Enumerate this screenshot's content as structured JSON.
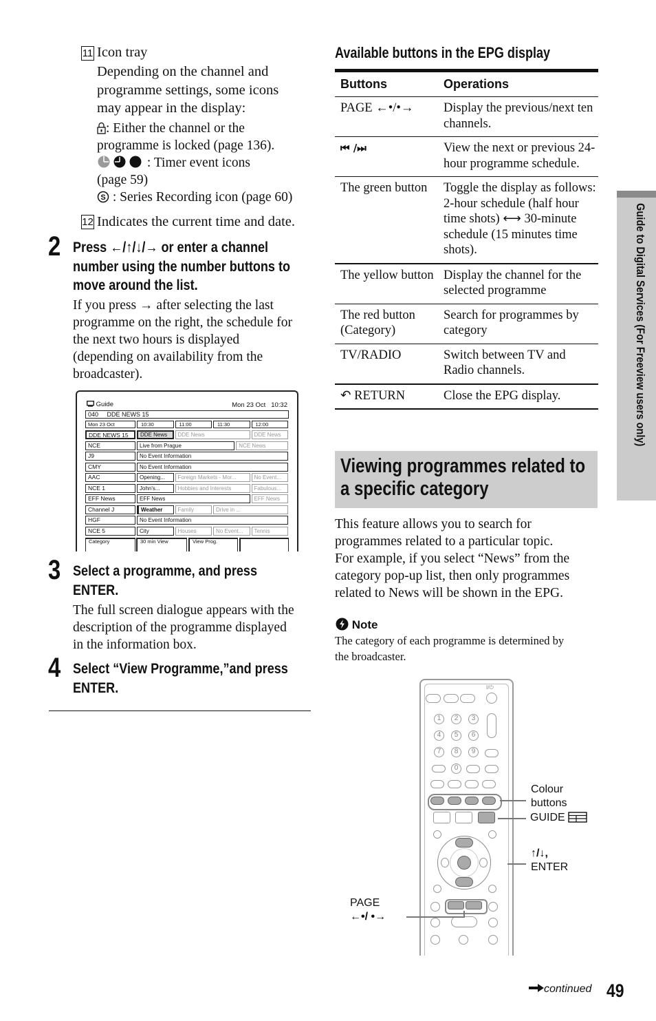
{
  "left_column": {
    "item11": {
      "number": "11",
      "title": "Icon tray",
      "description": [
        "Depending on the channel and",
        "programme settings, some icons",
        "may appear in the display:"
      ],
      "lock_icon_text": [
        ": Either the channel or the",
        "programme is locked (page 136)."
      ],
      "timer_icons_text": [
        ": Timer event icons",
        "(page 59)"
      ],
      "series_icon_text": ": Series Recording icon (page 60)"
    },
    "item12": {
      "number": "12",
      "text": "Indicates the current time and date."
    },
    "step2": {
      "number": "2",
      "title_lines": [
        "Press ←/↑/↓/→ or enter a channel",
        "number using the number buttons to",
        "move around the list."
      ],
      "body_lines": [
        "If you press → after selecting the last",
        "programme on the right, the schedule for",
        "the next two hours is displayed",
        "(depending on availability from the",
        "broadcaster)."
      ]
    },
    "step3": {
      "number": "3",
      "title_lines": [
        "Select a programme, and press",
        "ENTER."
      ],
      "body_lines": [
        "The full screen dialogue appears with the",
        "description of the programme displayed",
        "in the information box."
      ]
    },
    "step4": {
      "number": "4",
      "title_lines": [
        "Select “View Programme,”and press",
        "ENTER."
      ]
    }
  },
  "epg_screen": {
    "title": "Guide",
    "datetime": "Mon 23 Oct   10:32",
    "current_channel": "040     DDE NEWS 15",
    "date_cell": "Mon 23 Oct",
    "times": [
      "10:30",
      "11:00",
      "11:30",
      "12:00"
    ],
    "rows": [
      {
        "channel": "DDE NEWS 15",
        "programmes": [
          {
            "title": "DDE News",
            "span": 1,
            "style": "selected"
          },
          {
            "title": "DDE News",
            "span": 2,
            "style": "dim"
          },
          {
            "title": "DDE News",
            "span": 1,
            "style": "dim"
          }
        ]
      },
      {
        "channel": "NCE",
        "programmes": [
          {
            "title": "Live from Prague",
            "span": 2.6,
            "style": "normal"
          },
          {
            "title": "NCE News",
            "span": 1.4,
            "style": "dim"
          }
        ]
      },
      {
        "channel": "J9",
        "programmes": [
          {
            "title": "No Event Information",
            "span": 4,
            "style": "normal"
          }
        ]
      },
      {
        "channel": "CMY",
        "programmes": [
          {
            "title": "No Event Information",
            "span": 4,
            "style": "normal"
          }
        ]
      },
      {
        "channel": "AAC",
        "programmes": [
          {
            "title": "Opening...",
            "span": 1,
            "style": "normal"
          },
          {
            "title": "Foreign Markets - Mor...",
            "span": 2,
            "style": "dim"
          },
          {
            "title": "No Event...",
            "span": 1,
            "style": "dim"
          }
        ]
      },
      {
        "channel": "NCE 1",
        "programmes": [
          {
            "title": "John's...",
            "span": 1,
            "style": "normal"
          },
          {
            "title": "Hobbies and Interests",
            "span": 2,
            "style": "dim"
          },
          {
            "title": "Fabulous...",
            "span": 1,
            "style": "dim"
          }
        ]
      },
      {
        "channel": "EFF News",
        "programmes": [
          {
            "title": "EFF News",
            "span": 3,
            "style": "normal"
          },
          {
            "title": "EFF News",
            "span": 1,
            "style": "dim"
          }
        ]
      },
      {
        "channel": "Channel J",
        "programmes": [
          {
            "title": "Weather",
            "span": 1,
            "style": "bold"
          },
          {
            "title": "Family",
            "span": 1,
            "style": "dim"
          },
          {
            "title": "Drive in ...",
            "span": 2,
            "style": "dim"
          }
        ]
      },
      {
        "channel": "HGF",
        "programmes": [
          {
            "title": "No Event Information",
            "span": 4,
            "style": "normal"
          }
        ]
      },
      {
        "channel": "NCE 5",
        "programmes": [
          {
            "title": "City",
            "span": 1,
            "style": "normal"
          },
          {
            "title": "Houses",
            "span": 1,
            "style": "dim"
          },
          {
            "title": "No Event...",
            "span": 1,
            "style": "dim"
          },
          {
            "title": "Tennis",
            "span": 1,
            "style": "dim"
          }
        ]
      }
    ],
    "footer_buttons": [
      "Category",
      "30 min View",
      "View Prog."
    ]
  },
  "buttons_table": {
    "title": "Available buttons in the EPG display",
    "headers": [
      "Buttons",
      "Operations"
    ],
    "rows": [
      {
        "button": "PAGE ←•/•→",
        "operation": "Display the previous/next ten channels."
      },
      {
        "button": "⏮ /⏭",
        "operation": "View the next or previous 24-hour programme schedule."
      },
      {
        "button": "The green button",
        "operation": "Toggle the display as follows:\n2-hour schedule (half hour time shots) ⟷ 30-minute schedule (15 minutes time shots)."
      },
      {
        "button": "The yellow button",
        "operation": "Display the channel for the selected programme"
      },
      {
        "button": "The red button (Category)",
        "operation": "Search for programmes by category"
      },
      {
        "button": "TV/RADIO",
        "operation": "Switch between TV and Radio channels."
      },
      {
        "button": "↶ RETURN",
        "operation": "Close the EPG display."
      }
    ]
  },
  "section": {
    "title_lines": [
      "Viewing programmes related to",
      "a specific category"
    ],
    "body_lines": [
      "This feature allows you to search for",
      "programmes related to a particular topic.",
      "For example, if you select “News” from the",
      "category pop-up list, then only programmes",
      "related to News will be shown in the EPG."
    ],
    "note_label": "Note",
    "note_lines": [
      "The category of each programme is determined by",
      "the broadcaster."
    ]
  },
  "remote_diagram": {
    "number_buttons": [
      "1",
      "2",
      "3",
      "4",
      "5",
      "6",
      "7",
      "8",
      "9",
      "0"
    ],
    "power_label": "I/⏻",
    "callouts": {
      "colour_buttons": [
        "Colour",
        "buttons"
      ],
      "guide": "GUIDE",
      "up_down_enter": [
        "↑/↓,",
        "ENTER"
      ],
      "page": [
        "PAGE",
        "←•/ •→"
      ]
    }
  },
  "side_tab": {
    "label": "Guide to Digital Services (For Freeview users only)"
  },
  "footer": {
    "continued": "continued",
    "page_number": "49"
  }
}
